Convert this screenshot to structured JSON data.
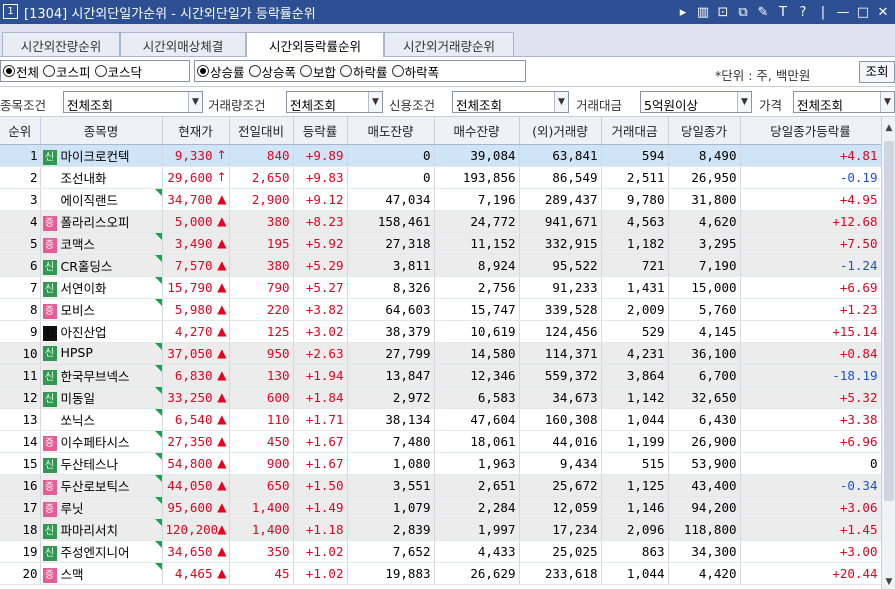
{
  "window": {
    "number": "1",
    "title": "[1304] 시간외단일가순위 - 시간외단일가 등락률순위",
    "controls": [
      "▸",
      "▥",
      "⊡",
      "⧉",
      "✎",
      "T",
      "?",
      "|",
      "—",
      "□",
      "✕"
    ]
  },
  "tabs": [
    {
      "label": "시간외잔량순위",
      "active": false
    },
    {
      "label": "시간외매상체결",
      "active": false
    },
    {
      "label": "시간외등락률순위",
      "active": true
    },
    {
      "label": "시간외거래량순위",
      "active": false
    }
  ],
  "market_filter": [
    {
      "label": "전체",
      "checked": true
    },
    {
      "label": "코스피",
      "checked": false
    },
    {
      "label": "코스닥",
      "checked": false
    }
  ],
  "sort_filter": [
    {
      "label": "상승률",
      "checked": true
    },
    {
      "label": "상승폭",
      "checked": false
    },
    {
      "label": "보합",
      "checked": false
    },
    {
      "label": "하락률",
      "checked": false
    },
    {
      "label": "하락폭",
      "checked": false
    }
  ],
  "unit_label": "*단위 : 주, 백만원",
  "query_button": "조회",
  "conditions": {
    "item_label": "종목조건",
    "item_value": "전체조회",
    "volume_label": "거래량조건",
    "volume_value": "전체조회",
    "credit_label": "신용조건",
    "credit_value": "전체조회",
    "amount_label": "거래대금",
    "amount_value": "5억원이상",
    "price_label": "가격",
    "price_value": "전체조회"
  },
  "columns": [
    "순위",
    "종목명",
    "현재가",
    "전일대비",
    "등락률",
    "매도잔량",
    "매수잔량",
    "(외)거래량",
    "거래대금",
    "당일종가",
    "당일종가등락률"
  ],
  "colors": {
    "up": "#e8001e",
    "down": "#1a4fd8",
    "title_bar": "#2d4f93",
    "selected_row": "#cfe4f7"
  },
  "rows": [
    {
      "rank": "1",
      "mark": "신",
      "mark_color": "green",
      "name": "마이크로컨텍",
      "corner": false,
      "price": "9,330",
      "arrow": "↑",
      "change": "840",
      "rate": "+9.89",
      "ask": "0",
      "bid": "39,084",
      "volume": "63,841",
      "amount": "594",
      "close": "8,490",
      "close_rate": "+4.81",
      "close_color": "red",
      "shade": "sel"
    },
    {
      "rank": "2",
      "mark": "",
      "mark_color": "none",
      "name": "조선내화",
      "corner": false,
      "price": "29,600",
      "arrow": "↑",
      "change": "2,650",
      "rate": "+9.83",
      "ask": "0",
      "bid": "193,856",
      "volume": "86,549",
      "amount": "2,511",
      "close": "26,950",
      "close_rate": "-0.19",
      "close_color": "blue",
      "shade": ""
    },
    {
      "rank": "3",
      "mark": "",
      "mark_color": "none",
      "name": "에이직랜드",
      "corner": true,
      "price": "34,700",
      "arrow": "▲",
      "change": "2,900",
      "rate": "+9.12",
      "ask": "47,034",
      "bid": "7,196",
      "volume": "289,437",
      "amount": "9,780",
      "close": "31,800",
      "close_rate": "+4.95",
      "close_color": "red",
      "shade": ""
    },
    {
      "rank": "4",
      "mark": "증",
      "mark_color": "pink",
      "name": "폴라리스오피",
      "corner": false,
      "price": "5,000",
      "arrow": "▲",
      "change": "380",
      "rate": "+8.23",
      "ask": "158,461",
      "bid": "24,772",
      "volume": "941,671",
      "amount": "4,563",
      "close": "4,620",
      "close_rate": "+12.68",
      "close_color": "red",
      "shade": "gray"
    },
    {
      "rank": "5",
      "mark": "증",
      "mark_color": "pink",
      "name": "코맥스",
      "corner": true,
      "price": "3,490",
      "arrow": "▲",
      "change": "195",
      "rate": "+5.92",
      "ask": "27,318",
      "bid": "11,152",
      "volume": "332,915",
      "amount": "1,182",
      "close": "3,295",
      "close_rate": "+7.50",
      "close_color": "red",
      "shade": "gray"
    },
    {
      "rank": "6",
      "mark": "신",
      "mark_color": "green",
      "name": "CR홀딩스",
      "corner": true,
      "price": "7,570",
      "arrow": "▲",
      "change": "380",
      "rate": "+5.29",
      "ask": "3,811",
      "bid": "8,924",
      "volume": "95,522",
      "amount": "721",
      "close": "7,190",
      "close_rate": "-1.24",
      "close_color": "blue",
      "shade": "gray"
    },
    {
      "rank": "7",
      "mark": "신",
      "mark_color": "green",
      "name": "서연이화",
      "corner": true,
      "price": "15,790",
      "arrow": "▲",
      "change": "790",
      "rate": "+5.27",
      "ask": "8,326",
      "bid": "2,756",
      "volume": "91,233",
      "amount": "1,431",
      "close": "15,000",
      "close_rate": "+6.69",
      "close_color": "red",
      "shade": ""
    },
    {
      "rank": "8",
      "mark": "증",
      "mark_color": "pink",
      "name": "모비스",
      "corner": true,
      "price": "5,980",
      "arrow": "▲",
      "change": "220",
      "rate": "+3.82",
      "ask": "64,603",
      "bid": "15,747",
      "volume": "339,528",
      "amount": "2,009",
      "close": "5,760",
      "close_rate": "+1.23",
      "close_color": "red",
      "shade": ""
    },
    {
      "rank": "9",
      "mark": "신",
      "mark_color": "black",
      "name": "아진산업",
      "corner": false,
      "price": "4,270",
      "arrow": "▲",
      "change": "125",
      "rate": "+3.02",
      "ask": "38,379",
      "bid": "10,619",
      "volume": "124,456",
      "amount": "529",
      "close": "4,145",
      "close_rate": "+15.14",
      "close_color": "red",
      "shade": ""
    },
    {
      "rank": "10",
      "mark": "신",
      "mark_color": "green",
      "name": "HPSP",
      "corner": true,
      "price": "37,050",
      "arrow": "▲",
      "change": "950",
      "rate": "+2.63",
      "ask": "27,799",
      "bid": "14,580",
      "volume": "114,371",
      "amount": "4,231",
      "close": "36,100",
      "close_rate": "+0.84",
      "close_color": "red",
      "shade": "gray"
    },
    {
      "rank": "11",
      "mark": "신",
      "mark_color": "green",
      "name": "한국무브넥스",
      "corner": true,
      "price": "6,830",
      "arrow": "▲",
      "change": "130",
      "rate": "+1.94",
      "ask": "13,847",
      "bid": "12,346",
      "volume": "559,372",
      "amount": "3,864",
      "close": "6,700",
      "close_rate": "-18.19",
      "close_color": "blue",
      "shade": "gray"
    },
    {
      "rank": "12",
      "mark": "신",
      "mark_color": "green",
      "name": "미동일",
      "corner": true,
      "price": "33,250",
      "arrow": "▲",
      "change": "600",
      "rate": "+1.84",
      "ask": "2,972",
      "bid": "6,583",
      "volume": "34,673",
      "amount": "1,142",
      "close": "32,650",
      "close_rate": "+5.32",
      "close_color": "red",
      "shade": "gray"
    },
    {
      "rank": "13",
      "mark": "",
      "mark_color": "none",
      "name": "쏘닉스",
      "corner": true,
      "price": "6,540",
      "arrow": "▲",
      "change": "110",
      "rate": "+1.71",
      "ask": "38,134",
      "bid": "47,604",
      "volume": "160,308",
      "amount": "1,044",
      "close": "6,430",
      "close_rate": "+3.38",
      "close_color": "red",
      "shade": ""
    },
    {
      "rank": "14",
      "mark": "증",
      "mark_color": "pink",
      "name": "이수페타시스",
      "corner": true,
      "price": "27,350",
      "arrow": "▲",
      "change": "450",
      "rate": "+1.67",
      "ask": "7,480",
      "bid": "18,061",
      "volume": "44,016",
      "amount": "1,199",
      "close": "26,900",
      "close_rate": "+6.96",
      "close_color": "red",
      "shade": ""
    },
    {
      "rank": "15",
      "mark": "신",
      "mark_color": "green",
      "name": "두산테스나",
      "corner": true,
      "price": "54,800",
      "arrow": "▲",
      "change": "900",
      "rate": "+1.67",
      "ask": "1,080",
      "bid": "1,963",
      "volume": "9,434",
      "amount": "515",
      "close": "53,900",
      "close_rate": "0",
      "close_color": "black",
      "shade": ""
    },
    {
      "rank": "16",
      "mark": "증",
      "mark_color": "pink",
      "name": "두산로보틱스",
      "corner": true,
      "price": "44,050",
      "arrow": "▲",
      "change": "650",
      "rate": "+1.50",
      "ask": "3,551",
      "bid": "2,651",
      "volume": "25,672",
      "amount": "1,125",
      "close": "43,400",
      "close_rate": "-0.34",
      "close_color": "blue",
      "shade": "gray"
    },
    {
      "rank": "17",
      "mark": "증",
      "mark_color": "pink",
      "name": "루닛",
      "corner": true,
      "price": "95,600",
      "arrow": "▲",
      "change": "1,400",
      "rate": "+1.49",
      "ask": "1,079",
      "bid": "2,284",
      "volume": "12,059",
      "amount": "1,146",
      "close": "94,200",
      "close_rate": "+3.06",
      "close_color": "red",
      "shade": "gray"
    },
    {
      "rank": "18",
      "mark": "신",
      "mark_color": "green",
      "name": "파마리서치",
      "corner": true,
      "price": "120,200",
      "arrow": "▲",
      "change": "1,400",
      "rate": "+1.18",
      "ask": "2,839",
      "bid": "1,997",
      "volume": "17,234",
      "amount": "2,096",
      "close": "118,800",
      "close_rate": "+1.45",
      "close_color": "red",
      "shade": "gray"
    },
    {
      "rank": "19",
      "mark": "신",
      "mark_color": "green",
      "name": "주성엔지니어",
      "corner": true,
      "price": "34,650",
      "arrow": "▲",
      "change": "350",
      "rate": "+1.02",
      "ask": "7,652",
      "bid": "4,433",
      "volume": "25,025",
      "amount": "863",
      "close": "34,300",
      "close_rate": "+3.00",
      "close_color": "red",
      "shade": ""
    },
    {
      "rank": "20",
      "mark": "증",
      "mark_color": "pink",
      "name": "스맥",
      "corner": true,
      "price": "4,465",
      "arrow": "▲",
      "change": "45",
      "rate": "+1.02",
      "ask": "19,883",
      "bid": "26,629",
      "volume": "233,618",
      "amount": "1,044",
      "close": "4,420",
      "close_rate": "+20.44",
      "close_color": "red",
      "shade": ""
    }
  ]
}
